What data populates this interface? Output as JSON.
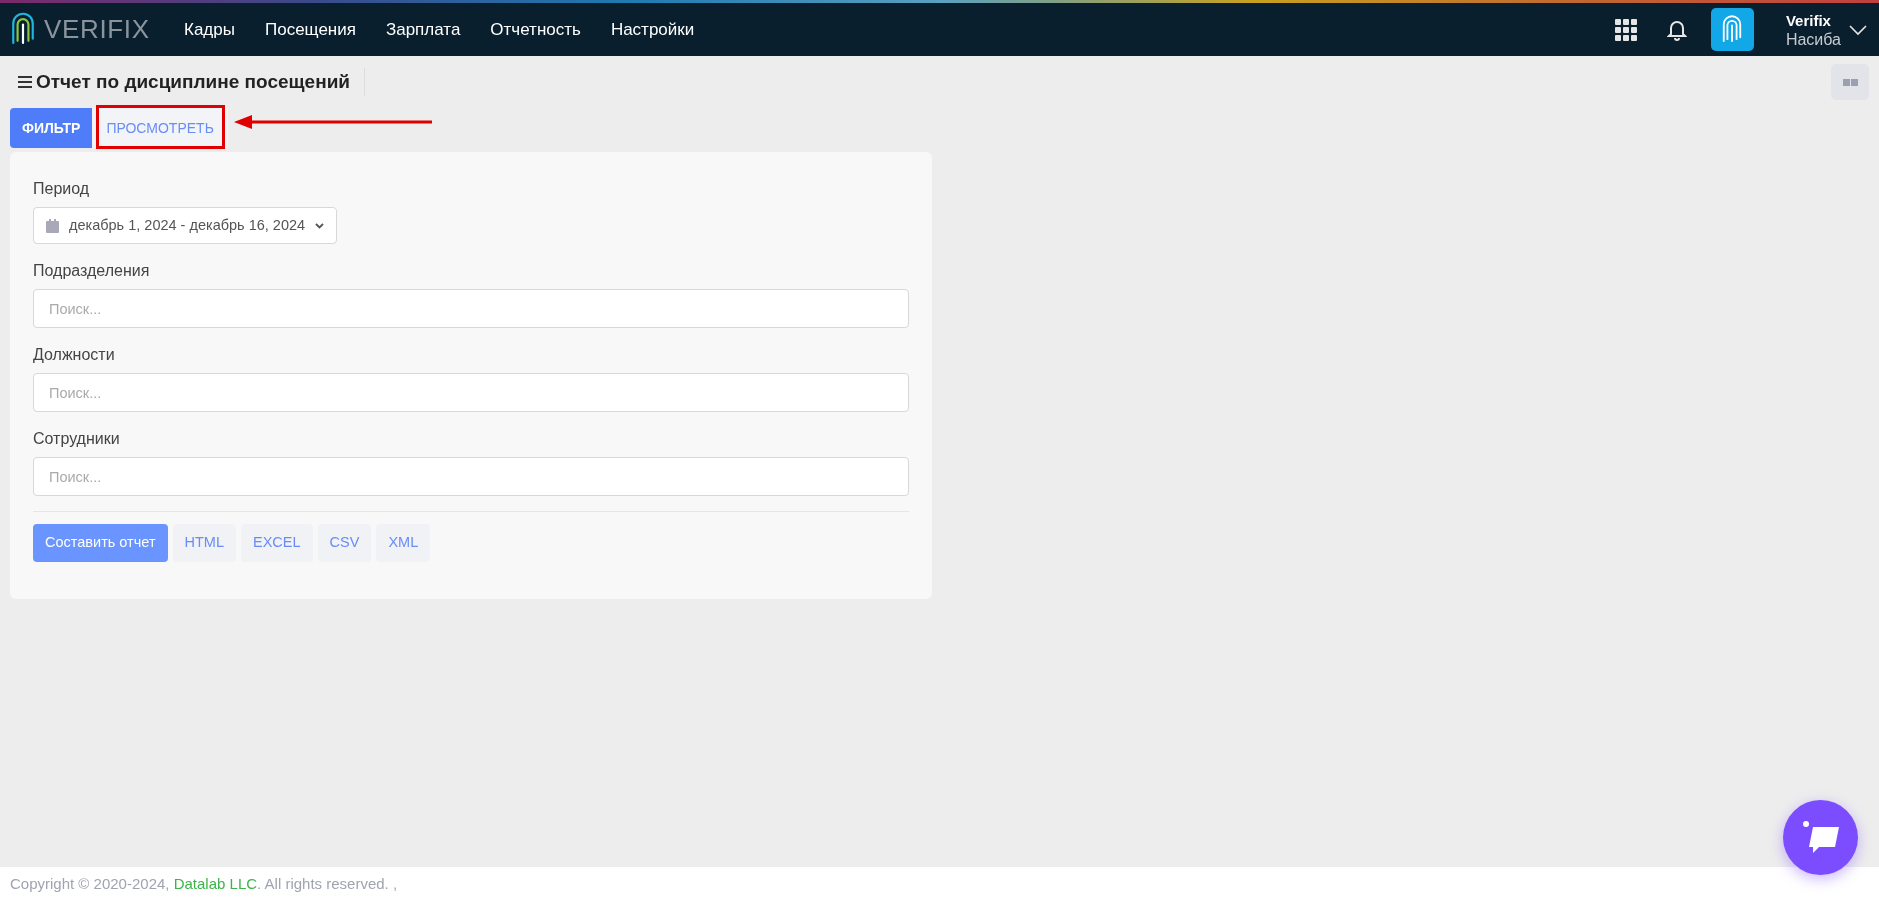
{
  "header": {
    "logo": "VERIFIX",
    "nav": [
      {
        "label": "Кадры"
      },
      {
        "label": "Посещения"
      },
      {
        "label": "Зарплата"
      },
      {
        "label": "Отчетность"
      },
      {
        "label": "Настройки"
      }
    ],
    "user": {
      "company": "Verifix",
      "name": "Насиба"
    }
  },
  "page": {
    "title": "Отчет по дисциплине посещений"
  },
  "tabs": [
    {
      "label": "ФИЛЬТР",
      "selected": true
    },
    {
      "label": "ПРОСМОТРЕТЬ",
      "selected": false
    }
  ],
  "filter": {
    "period": {
      "label": "Период",
      "value": "декабрь 1, 2024 - декабрь 16, 2024"
    },
    "fields": [
      {
        "label": "Подразделения",
        "placeholder": "Поиск..."
      },
      {
        "label": "Должности",
        "placeholder": "Поиск..."
      },
      {
        "label": "Сотрудники",
        "placeholder": "Поиск..."
      }
    ],
    "primary_button": "Составить отчет",
    "export_buttons": [
      "HTML",
      "EXCEL",
      "CSV",
      "XML"
    ]
  },
  "footer": {
    "prefix": "Copyright © 2020-2024,",
    "link": "Datalab LLC",
    "suffix": ". All rights reserved. ,"
  }
}
